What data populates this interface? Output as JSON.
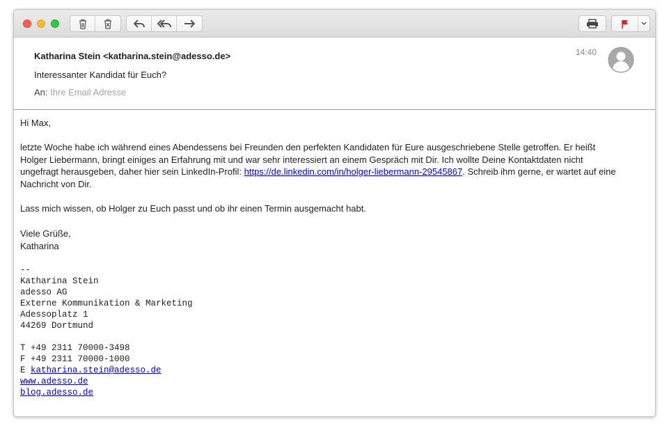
{
  "toolbar": {
    "icons": [
      "trash-icon",
      "junk-icon",
      "reply-icon",
      "reply-all-icon",
      "forward-icon",
      "print-icon",
      "flag-icon",
      "chevron-down-icon"
    ],
    "flag_color": "#e02020"
  },
  "email": {
    "from": "Katharina Stein <katharina.stein@adesso.de>",
    "subject": "Interessanter Kandidat für Euch?",
    "to_label": "An:",
    "to_value": "Ihre Email Adresse",
    "time": "14:40"
  },
  "body": {
    "greeting": "Hi Max,",
    "para1_before": "letzte Woche habe ich während eines Abendessens bei Freunden den perfekten Kandidaten für Eure ausgeschriebene Stelle getroffen. Er heißt Holger Liebermann, bringt einiges an Erfahrung mit und war sehr interessiert an einem Gespräch mit Dir. Ich wollte Deine Kontaktdaten nicht ungefragt herausgeben, daher hier sein LinkedIn-Profil: ",
    "para1_link": "https://de.linkedin.com/in/holger-liebermann-29545867",
    "para1_after": ". Schreib ihm gerne, er wartet auf eine Nachricht von Dir.",
    "para2": "Lass mich wissen, ob Holger zu Euch passt und ob ihr einen Termin ausgemacht habt.",
    "closing": "Viele Grüße,",
    "name": "Katharina"
  },
  "signature": {
    "separator": "--",
    "name": "Katharina Stein",
    "company": "adesso AG",
    "department": "Externe Kommunikation & Marketing",
    "street": "Adessoplatz 1",
    "city": "44269 Dortmund",
    "phone": "T +49 2311 70000-3498",
    "fax": "F +49 2311 70000-1000",
    "email_prefix": "E ",
    "email": "katharina.stein@adesso.de",
    "website": "www.adesso.de",
    "blog": "blog.adesso.de"
  }
}
